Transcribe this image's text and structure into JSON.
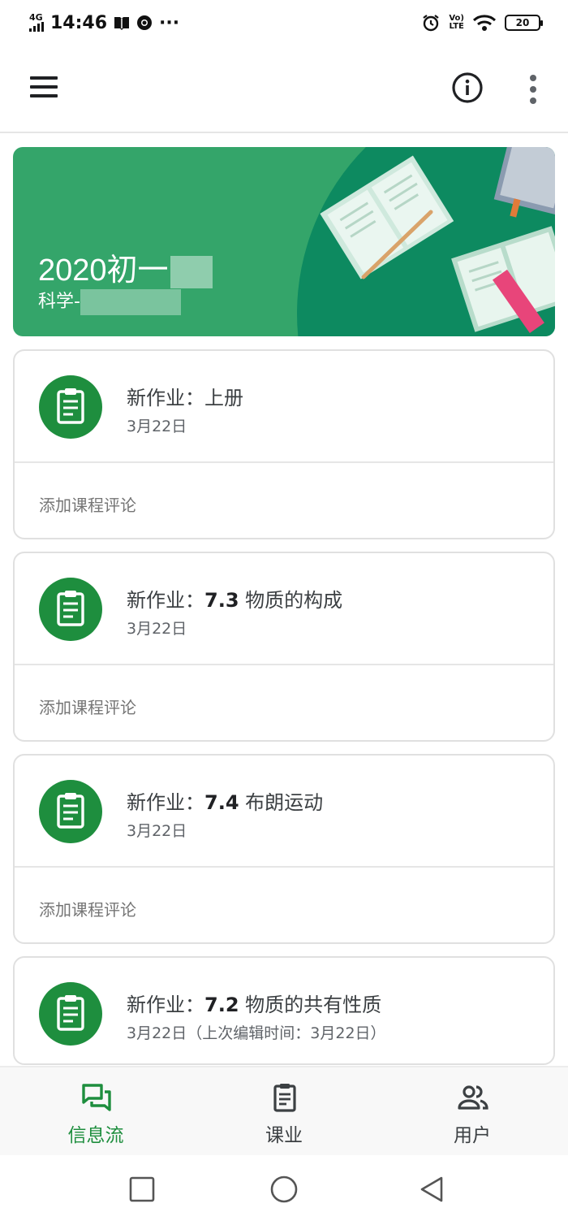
{
  "status_bar": {
    "network": "4G",
    "time": "14:46",
    "more": "···",
    "volte_top": "Vo)",
    "volte_bottom": "LTE",
    "battery": "20"
  },
  "app_bar": {
    "menu_icon": "hamburger-menu-icon",
    "info_icon": "info-icon",
    "more_icon": "more-vert-icon"
  },
  "banner": {
    "class_title": "2020初一",
    "class_subtitle": "科学-",
    "background_color": "#34a56a",
    "accent_color": "#0d8a60"
  },
  "feed": {
    "items": [
      {
        "prefix": "新作业：",
        "number": "",
        "title": "上册",
        "date": "3月22日",
        "comment_placeholder": "添加课程评论"
      },
      {
        "prefix": "新作业：",
        "number": "7.3",
        "title": "物质的构成",
        "date": "3月22日",
        "comment_placeholder": "添加课程评论"
      },
      {
        "prefix": "新作业：",
        "number": "7.4",
        "title": "布朗运动",
        "date": "3月22日",
        "comment_placeholder": "添加课程评论"
      },
      {
        "prefix": "新作业：",
        "number": "7.2",
        "title": "物质的共有性质",
        "date": "3月22日（上次编辑时间：3月22日）"
      }
    ],
    "icon": "assignment-icon",
    "icon_color": "#1e8e3e"
  },
  "bottom_nav": {
    "items": [
      {
        "label": "信息流",
        "icon": "stream-icon",
        "active": true
      },
      {
        "label": "课业",
        "icon": "classwork-icon",
        "active": false
      },
      {
        "label": "用户",
        "icon": "people-icon",
        "active": false
      }
    ],
    "active_color": "#1e8e3e"
  },
  "system_nav": {
    "icons": [
      "recents-square-icon",
      "home-circle-icon",
      "back-triangle-icon"
    ]
  }
}
